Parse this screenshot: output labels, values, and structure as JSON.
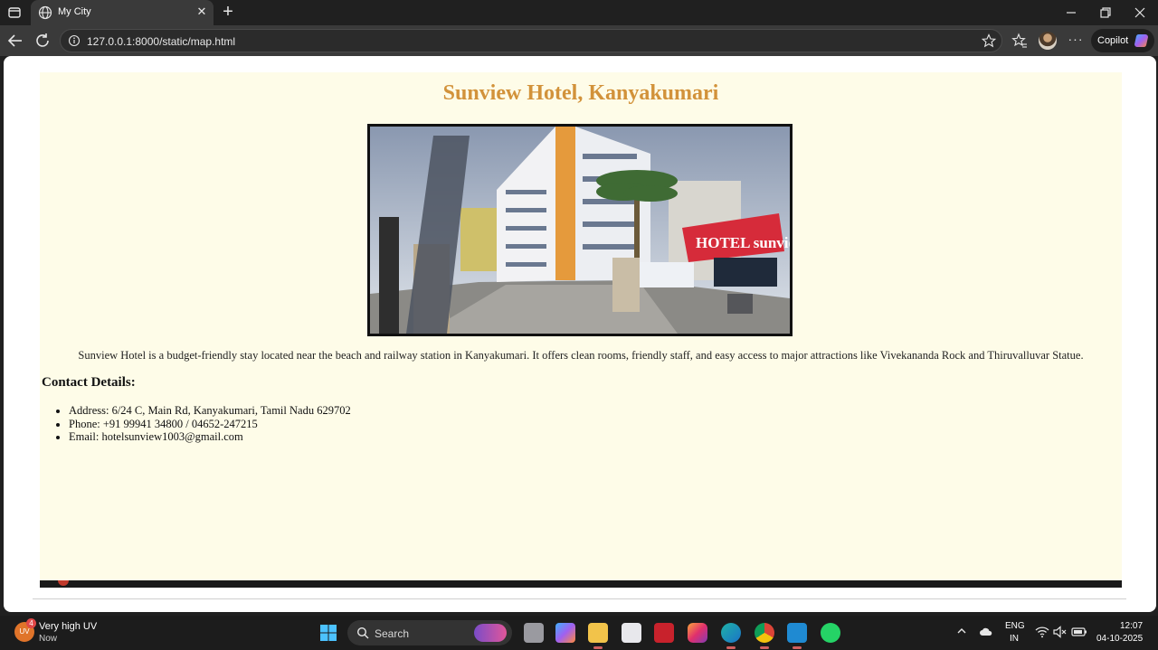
{
  "browser": {
    "tab_title": "My City",
    "url": "127.0.0.1:8000/static/map.html",
    "copilot_label": "Copilot"
  },
  "page": {
    "title": "Sunview Hotel, Kanyakumari",
    "image_alt": "Sunview Hotel building photo",
    "sign_text": "HOTEL sunview",
    "description": "Sunview Hotel is a budget-friendly stay located near the beach and railway station in Kanyakumari. It offers clean rooms, friendly staff, and easy access to major attractions like Vivekananda Rock and Thiruvalluvar Statue.",
    "contact_heading": "Contact Details:",
    "contacts": [
      "Address: 6/24 C, Main Rd, Kanyakumari, Tamil Nadu 629702",
      "Phone: +91 99941 34800 / 04652-247215",
      "Email: hotelsunview1003@gmail.com"
    ],
    "title_color": "#d2923a",
    "background_color": "#fefce8"
  },
  "taskbar": {
    "weather_title": "Very high UV",
    "weather_sub": "Now",
    "weather_badge": "4",
    "weather_icon_text": "UV",
    "search_label": "Search",
    "lang_line1": "ENG",
    "lang_line2": "IN",
    "time": "12:07",
    "date": "04-10-2025",
    "apps": [
      "task-view",
      "copilot-app",
      "file-explorer",
      "microsoft-store",
      "mcafee",
      "instagram",
      "edge",
      "chrome",
      "vscode",
      "whatsapp"
    ]
  }
}
